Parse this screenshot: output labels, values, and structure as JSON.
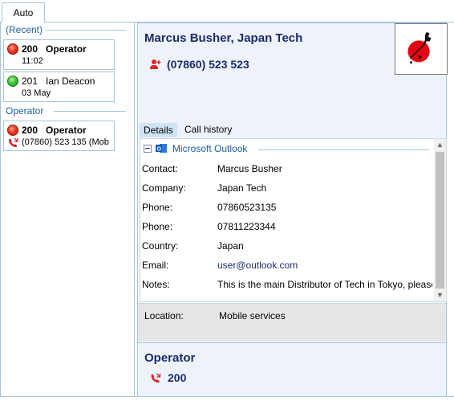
{
  "tabs": {
    "auto": "Auto"
  },
  "sidebar": {
    "recent_header": "(Recent)",
    "operator_header": "Operator",
    "recent_items": [
      {
        "status": "busy",
        "extension": "200",
        "name": "Operator",
        "detail": "11:02",
        "bold": true
      },
      {
        "status": "available",
        "extension": "201",
        "name": "Ian Deacon",
        "detail": "03 May",
        "bold": false
      }
    ],
    "operator_items": [
      {
        "status": "busy",
        "extension": "200",
        "name": "Operator",
        "detail": "(07860) 523 135  (Mob",
        "bold": true
      }
    ]
  },
  "contact": {
    "name": "Marcus Busher, Japan Tech",
    "phone": "(07860) 523 523",
    "tabs": [
      "Details",
      "Call history"
    ],
    "source": "Microsoft Outlook",
    "fields": [
      {
        "label": "Contact:",
        "value": "Marcus Busher"
      },
      {
        "label": "Company:",
        "value": "Japan Tech"
      },
      {
        "label": "Phone:",
        "value": "07860523135"
      },
      {
        "label": "Phone:",
        "value": "07811223344"
      },
      {
        "label": "Country:",
        "value": "Japan"
      },
      {
        "label": "Email:",
        "value": "user@outlook.com"
      },
      {
        "label": "Notes:",
        "value": "This is the main Distributor of Tech in Tokyo, please"
      }
    ],
    "location_label": "Location:",
    "location_value": "Mobile services"
  },
  "operator_card": {
    "name": "Operator",
    "number": "200"
  },
  "colors": {
    "accent": "#1f5fa6",
    "title": "#1b2b6b",
    "busy": "#e53b23",
    "available": "#3cc53a",
    "border": "#a7c4dc"
  },
  "icons": {
    "busy": "red-status-dot-icon",
    "available": "green-status-dot-icon",
    "call": "incoming-call-icon",
    "add_contact": "add-contact-icon",
    "outlook": "outlook-icon"
  }
}
